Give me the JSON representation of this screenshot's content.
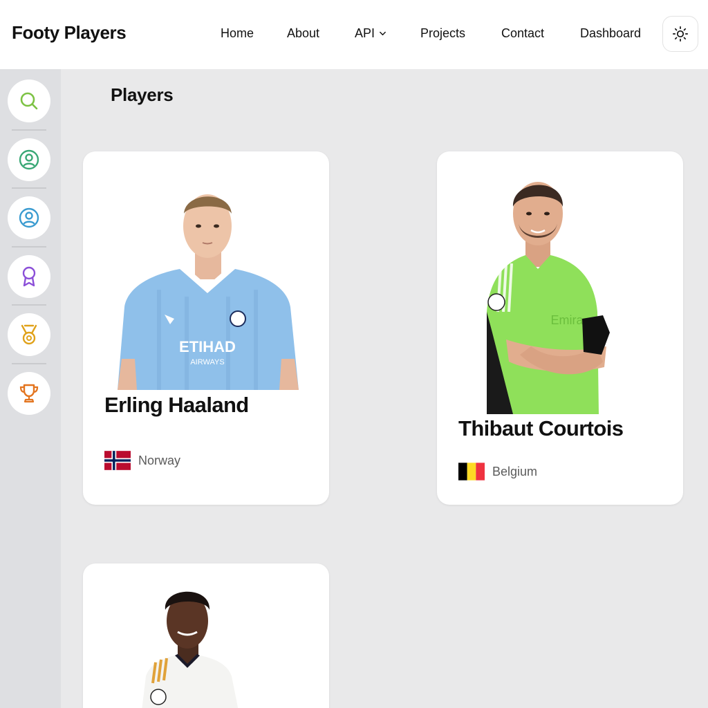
{
  "header": {
    "brand": "Footy Players",
    "nav": [
      "Home",
      "About",
      "API",
      "Projects",
      "Contact",
      "Dashboard"
    ],
    "theme_icon": "sun-icon"
  },
  "sidebar": {
    "icons": [
      "search-icon",
      "user-circle-icon",
      "user-circle-icon",
      "award-ribbon-icon",
      "medal-icon",
      "trophy-icon"
    ],
    "colors": [
      "#7cc243",
      "#3aa876",
      "#3a9bd0",
      "#8b4fd8",
      "#e0a21a",
      "#e3741e"
    ]
  },
  "main": {
    "title": "Players",
    "players": [
      {
        "name": "Erling Haaland",
        "country": "Norway"
      },
      {
        "name": "Thibaut Courtois",
        "country": "Belgium"
      },
      {
        "name": "",
        "country": ""
      }
    ]
  }
}
